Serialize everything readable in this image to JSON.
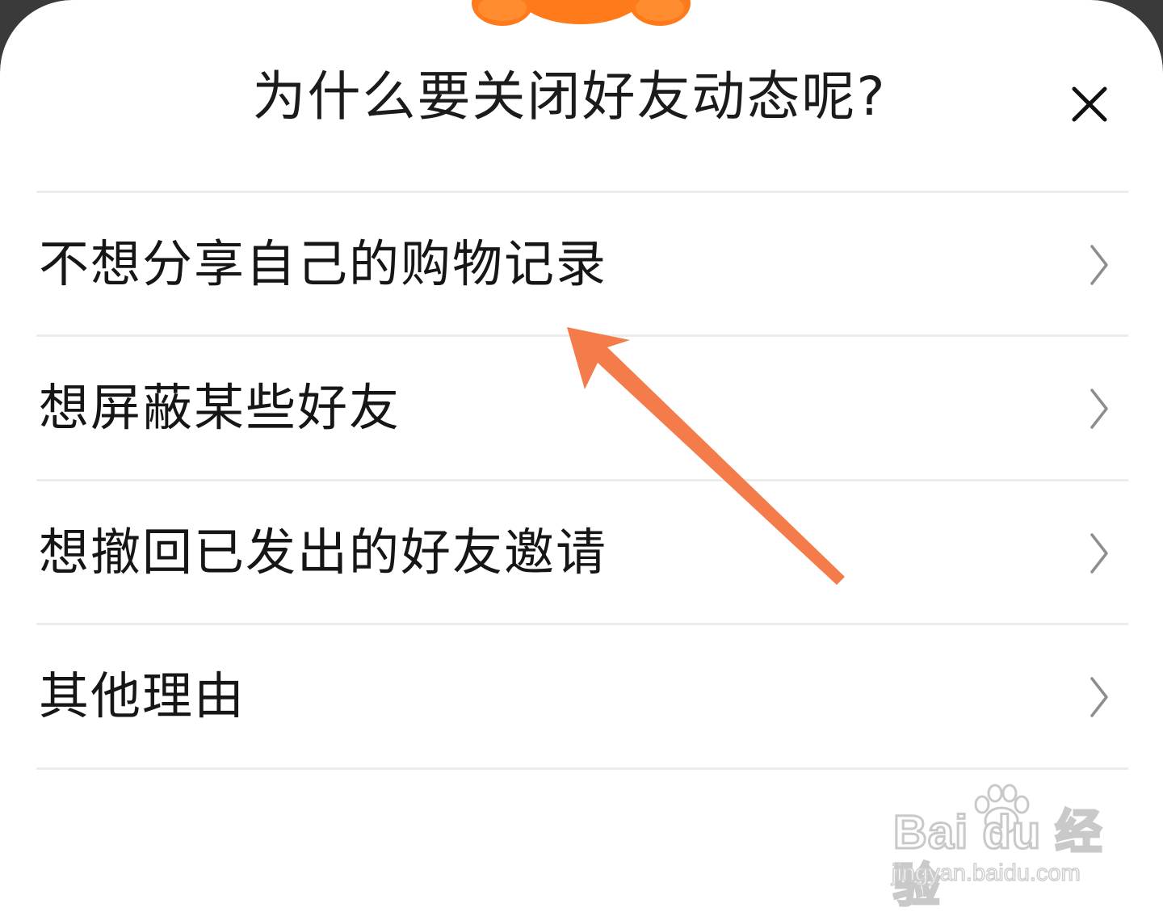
{
  "dialog": {
    "title": "为什么要关闭好友动态呢?",
    "close_icon": "close-icon"
  },
  "reasons": [
    {
      "label": "不想分享自己的购物记录",
      "icon": "chevron-right-icon"
    },
    {
      "label": "想屏蔽某些好友",
      "icon": "chevron-right-icon"
    },
    {
      "label": "想撤回已发出的好友邀请",
      "icon": "chevron-right-icon"
    },
    {
      "label": "其他理由",
      "icon": "chevron-right-icon"
    }
  ],
  "annotation": {
    "icon": "arrow-pointer-icon",
    "color": "#f47c4b"
  },
  "watermark": {
    "brand": "Bai du 经验",
    "url": "jingyan.baidu.com"
  },
  "colors": {
    "mascot": "#ff7a1a",
    "divider": "#ececec",
    "chevron": "#8a8f8c"
  }
}
